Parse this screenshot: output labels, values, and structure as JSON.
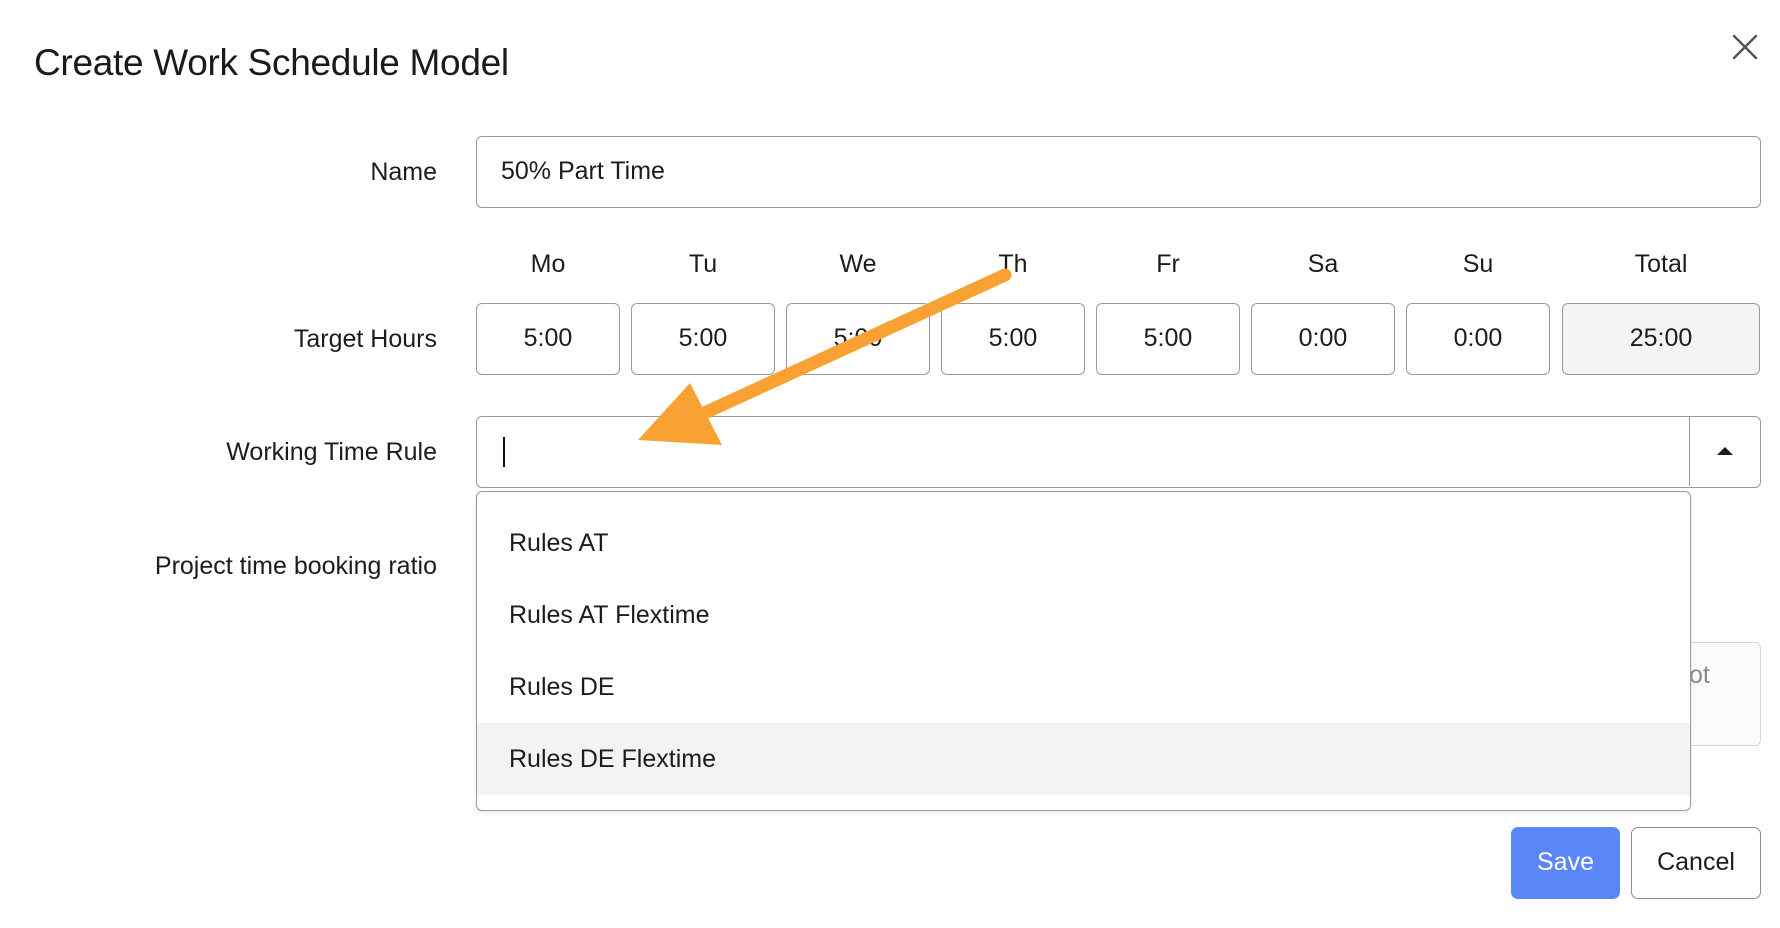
{
  "dialog": {
    "title": "Create Work Schedule Model",
    "close_icon": "close-icon"
  },
  "form": {
    "name_label": "Name",
    "name_value": "50% Part Time",
    "target_hours_label": "Target Hours",
    "days": [
      {
        "header": "Mo",
        "value": "5:00"
      },
      {
        "header": "Tu",
        "value": "5:00"
      },
      {
        "header": "We",
        "value": "5:00"
      },
      {
        "header": "Th",
        "value": "5:00"
      },
      {
        "header": "Fr",
        "value": "5:00"
      },
      {
        "header": "Sa",
        "value": "0:00"
      },
      {
        "header": "Su",
        "value": "0:00"
      }
    ],
    "total_header": "Total",
    "total_value": "25:00",
    "working_time_rule_label": "Working Time Rule",
    "working_time_rule_value": "",
    "project_ratio_label": "Project time booking ratio",
    "partially_hidden_text": "ot"
  },
  "dropdown": {
    "options": [
      {
        "label": "Rules AT"
      },
      {
        "label": "Rules AT Flextime"
      },
      {
        "label": "Rules DE"
      },
      {
        "label": "Rules DE Flextime"
      }
    ],
    "highlighted_index": 3
  },
  "buttons": {
    "save_label": "Save",
    "cancel_label": "Cancel"
  },
  "colors": {
    "accent": "#5b86f7",
    "annotation_arrow": "#f9a233",
    "highlight": "#f3f3f3"
  }
}
